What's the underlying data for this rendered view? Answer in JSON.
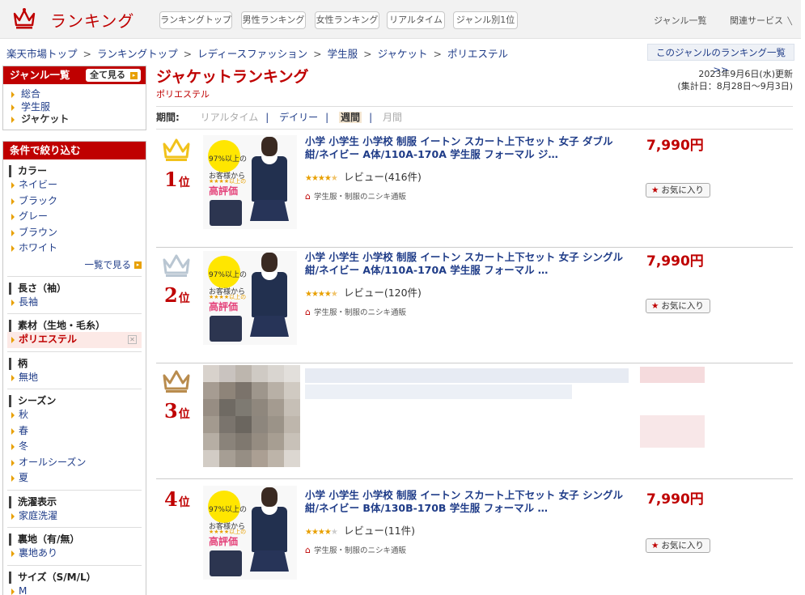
{
  "header": {
    "logo_icon": "crown-icon",
    "title": "ランキング",
    "nav": [
      "ランキングトップ",
      "男性ランキング",
      "女性ランキング",
      "リアルタイム",
      "ジャンル別1位"
    ],
    "right_links": [
      "ジャンル一覧",
      "関連サービス"
    ]
  },
  "breadcrumb": [
    "楽天市場トップ",
    "ランキングトップ",
    "レディースファッション",
    "学生服",
    "ジャケット",
    "ポリエステル"
  ],
  "breadcrumb_separator": ">",
  "genre_list_link": "このジャンルのランキング一覧 >>",
  "sidebar": {
    "genre_header": "ジャンル一覧",
    "show_all": "全て見る",
    "genres": [
      "総合",
      "学生服",
      "ジャケット"
    ],
    "filter_header": "条件で絞り込む",
    "sections": [
      {
        "title": "カラー",
        "items": [
          "ネイビー",
          "ブラック",
          "グレー",
          "ブラウン",
          "ホワイト"
        ],
        "more": "一覧で見る"
      },
      {
        "title": "長さ（袖）",
        "items": [
          "長袖"
        ]
      },
      {
        "title": "素材（生地・毛糸）",
        "items": [
          "ポリエステル"
        ],
        "selected": "ポリエステル"
      },
      {
        "title": "柄",
        "items": [
          "無地"
        ]
      },
      {
        "title": "シーズン",
        "items": [
          "秋",
          "春",
          "冬",
          "オールシーズン",
          "夏"
        ]
      },
      {
        "title": "洗濯表示",
        "items": [
          "家庭洗濯"
        ]
      },
      {
        "title": "裏地（有/無）",
        "items": [
          "裏地あり"
        ]
      },
      {
        "title": "サイズ（S/M/L）",
        "items": [
          "M"
        ]
      }
    ]
  },
  "main": {
    "title": "ジャケットランキング",
    "subgenre": "ポリエステル",
    "updated": "2023年9月6日(水)更新",
    "period_range": "(集計日：8月28日～9月3日)",
    "period_label": "期間:",
    "periods": [
      {
        "label": "リアルタイム",
        "state": "disabled"
      },
      {
        "label": "デイリー",
        "state": "link"
      },
      {
        "label": "週間",
        "state": "current"
      },
      {
        "label": "月間",
        "state": "disabled"
      }
    ]
  },
  "items": [
    {
      "rank": "1",
      "rank_suffix": "位",
      "crown_color": "#f1c21b",
      "title": "小学 小学生 小学校 制服 イートン スカート上下セット 女子 ダブル 紺/ネイビー A体/110A-170A 学生服 フォーマル ジ…",
      "rating": 4.5,
      "reviews": "レビュー(416件)",
      "shop": "学生服・制服のニシキ通販",
      "price": "7,990円",
      "fav": "お気に入り",
      "thumb": {
        "t1": "97%以上の",
        "t2": "お客様から",
        "t3": "★★★★以上の",
        "t4": "高評価"
      }
    },
    {
      "rank": "2",
      "rank_suffix": "位",
      "crown_color": "#b9c6d2",
      "title": "小学 小学生 小学校 制服 イートン スカート上下セット 女子 シングル 紺/ネイビー A体/110A-170A 学生服 フォーマル …",
      "rating": 4.5,
      "reviews": "レビュー(120件)",
      "shop": "学生服・制服のニシキ通販",
      "price": "7,990円",
      "fav": "お気に入り",
      "thumb": {
        "t1": "97%以上の",
        "t2": "お客様から",
        "t3": "★★★★以上の",
        "t4": "高評価"
      }
    },
    {
      "rank": "3",
      "rank_suffix": "位",
      "crown_color": "#b98c4e",
      "redacted": true
    },
    {
      "rank": "4",
      "rank_suffix": "位",
      "title": "小学 小学生 小学校 制服 イートン スカート上下セット 女子 シングル 紺/ネイビー B体/130B-170B 学生服 フォーマル …",
      "rating": 4.0,
      "reviews": "レビュー(11件)",
      "shop": "学生服・制服のニシキ通販",
      "price": "7,990円",
      "fav": "お気に入り",
      "thumb": {
        "t1": "97%以上の",
        "t2": "お客様から",
        "t3": "★★★★以上の",
        "t4": "高評価"
      }
    }
  ]
}
